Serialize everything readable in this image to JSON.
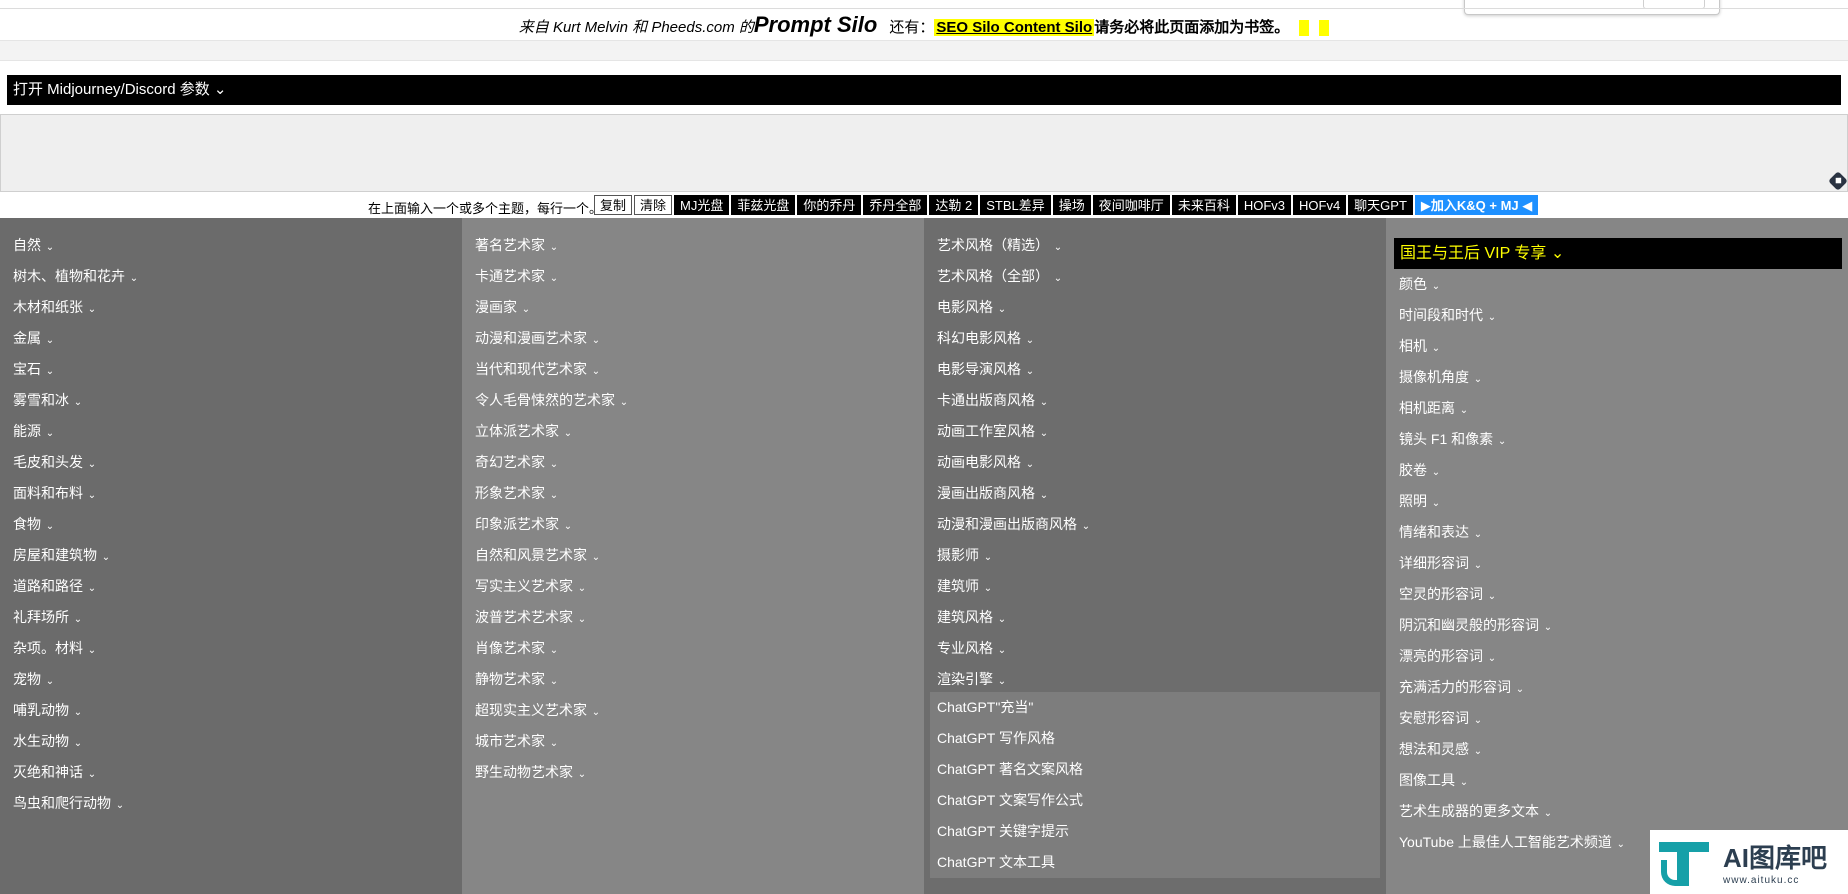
{
  "banner": {
    "source": "来自 Kurt Melvin 和 Pheeds.com 的",
    "brand": "Prompt Silo",
    "also": "还有：",
    "silo_link": "SEO Silo Content Silo",
    "note": "请务必将此页面添加为书签。"
  },
  "params_bar": {
    "label": "打开 Midjourney/Discord 参数",
    "caret": "⌄"
  },
  "toolbar": {
    "hint": "在上面输入一个或多个主题，每行一个。",
    "copy": "复制",
    "clear": "清除",
    "buttons": [
      "MJ光盘",
      "菲兹光盘",
      "你的乔丹",
      "乔丹全部",
      "达勒 2",
      "STBL差异",
      "操场",
      "夜间咖啡厅",
      "未来百科",
      "HOFv3",
      "HOFv4",
      "聊天GPT"
    ],
    "join": "▶加入K&Q + MJ ◀"
  },
  "columns": {
    "col1": [
      "自然",
      "树木、植物和花卉",
      "木材和纸张",
      "金属",
      "宝石",
      "雾雪和冰",
      "能源",
      "毛皮和头发",
      "面料和布料",
      "食物",
      "房屋和建筑物",
      "道路和路径",
      "礼拜场所",
      "杂项。材料",
      "宠物",
      "哺乳动物",
      "水生动物",
      "灭绝和神话",
      "鸟虫和爬行动物"
    ],
    "col2": [
      "著名艺术家",
      "卡通艺术家",
      "漫画家",
      "动漫和漫画艺术家",
      "当代和现代艺术家",
      "令人毛骨悚然的艺术家",
      "立体派艺术家",
      "奇幻艺术家",
      "形象艺术家",
      "印象派艺术家",
      "自然和风景艺术家",
      "写实主义艺术家",
      "波普艺术艺术家",
      "肖像艺术家",
      "静物艺术家",
      "超现实主义艺术家",
      "城市艺术家",
      "野生动物艺术家"
    ],
    "col3": [
      "艺术风格（精选）",
      "艺术风格（全部）",
      "电影风格",
      "科幻电影风格",
      "电影导演风格",
      "卡通出版商风格",
      "动画工作室风格",
      "动画电影风格",
      "漫画出版商风格",
      "动漫和漫画出版商风格",
      "摄影师",
      "建筑师",
      "建筑风格",
      "专业风格",
      "渲染引擎"
    ],
    "col3_chatgpt": [
      "ChatGPT\"充当\"",
      "ChatGPT 写作风格",
      "ChatGPT 著名文案风格",
      "ChatGPT 文案写作公式",
      "ChatGPT 关键字提示",
      "ChatGPT 文本工具"
    ],
    "col4_vip": "国王与王后 VIP 专享",
    "col4": [
      "颜色",
      "时间段和时代",
      "相机",
      "摄像机角度",
      "相机距离",
      "镜头 F1 和像素",
      "胶卷",
      "照明",
      "情绪和表达",
      "详细形容词",
      "空灵的形容词",
      "阴沉和幽灵般的形容词",
      "漂亮的形容词",
      "充满活力的形容词",
      "安慰形容词",
      "想法和灵感",
      "图像工具",
      "艺术生成器的更多文本",
      "YouTube 上最佳人工智能艺术频道"
    ]
  },
  "watermark": {
    "name": "AI图库吧",
    "url": "www.aituku.cc"
  },
  "colors": {
    "accent_yellow": "#ffff00",
    "bar_black": "#000000",
    "join_blue": "#1e90ff",
    "col_dark": "#6b6b6b",
    "col_light": "#868686",
    "watermark_teal": "#16a0a8"
  }
}
